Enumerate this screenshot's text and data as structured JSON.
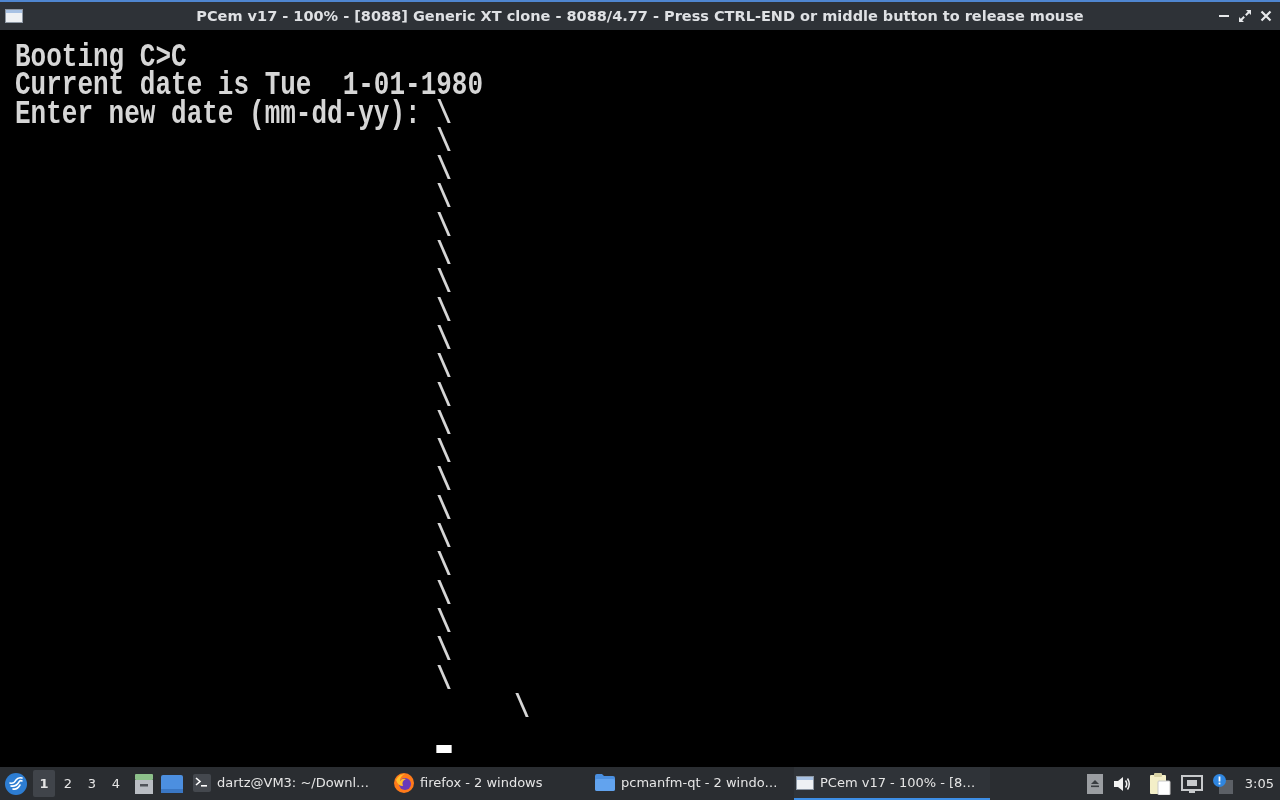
{
  "window": {
    "title": "PCem v17 - 100% - [8088] Generic XT clone - 8088/4.77 - Press CTRL-END or middle button to release mouse"
  },
  "screen": {
    "lines": [
      "Booting C>C",
      "Current date is Tue  1-01-1980",
      "Enter new date (mm-dd-yy): \\",
      "                           \\",
      "                           \\",
      "                           \\",
      "                           \\",
      "                           \\",
      "                           \\",
      "                           \\",
      "                           \\",
      "                           \\",
      "                           \\",
      "                           \\",
      "                           \\",
      "                           \\",
      "                           \\",
      "                           \\",
      "                           \\",
      "                           \\",
      "                           \\",
      "                           \\",
      "                           \\",
      "                                \\"
    ],
    "cursor": {
      "visible": true
    }
  },
  "taskbar": {
    "desktops": [
      {
        "label": "1",
        "selected": true
      },
      {
        "label": "2",
        "selected": false
      },
      {
        "label": "3",
        "selected": false
      },
      {
        "label": "4",
        "selected": false
      }
    ],
    "tasks": [
      {
        "kind": "terminal",
        "label": "dartz@VM3: ~/Downl…",
        "selected": false
      },
      {
        "kind": "browser",
        "label": "firefox - 2 windows",
        "selected": false
      },
      {
        "kind": "files",
        "label": "pcmanfm-qt - 2 windo…",
        "selected": false
      },
      {
        "kind": "emulator",
        "label": "PCem v17 - 100% - [8…",
        "selected": true
      }
    ],
    "clock": "3:05"
  }
}
